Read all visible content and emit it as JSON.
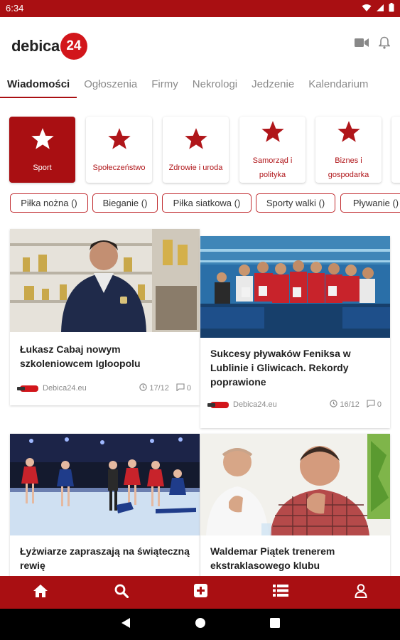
{
  "status": {
    "time": "6:34"
  },
  "app": {
    "logo_text": "debica",
    "logo_badge": "24"
  },
  "tabs": [
    "Wiadomości",
    "Ogłoszenia",
    "Firmy",
    "Nekrologi",
    "Jedzenie",
    "Kalendarium"
  ],
  "categories": [
    {
      "label": "Sport",
      "active": true
    },
    {
      "label": "Społeczeństwo",
      "active": false
    },
    {
      "label": "Zdrowie i uroda",
      "active": false
    },
    {
      "label": "Samorząd i polityka",
      "active": false
    },
    {
      "label": "Biznes i gospodarka",
      "active": false
    }
  ],
  "subcategories": [
    "Piłka nożna ()",
    "Bieganie ()",
    "Piłka siatkowa ()",
    "Sporty walki ()",
    "Pływanie ()"
  ],
  "articles": [
    {
      "title": "Łukasz Cabaj nowym szkoleniowcem Igloopolu",
      "source": "Debica24.eu",
      "date": "17/12",
      "comments": "0"
    },
    {
      "title": "Sukcesy pływaków Feniksa w Lublinie i Gliwicach. Rekordy poprawione",
      "source": "Debica24.eu",
      "date": "16/12",
      "comments": "0"
    },
    {
      "title": "Łyżwiarze zapraszają na świąteczną rewię",
      "source": "",
      "date": "",
      "comments": ""
    },
    {
      "title": "Waldemar Piątek trenerem ekstraklasowego klubu",
      "source": "",
      "date": "",
      "comments": ""
    }
  ],
  "colors": {
    "brand": "#a90f12",
    "accent_red": "#d2161b"
  },
  "icons": {
    "status": [
      "wifi-icon",
      "signal-icon",
      "battery-icon"
    ],
    "appbar": [
      "video-camera-icon",
      "bell-icon"
    ],
    "bottom_nav": [
      "home-icon",
      "search-icon",
      "add-icon",
      "list-icon",
      "profile-icon"
    ],
    "system_nav": [
      "back-icon",
      "home-circle-icon",
      "recents-icon"
    ]
  }
}
